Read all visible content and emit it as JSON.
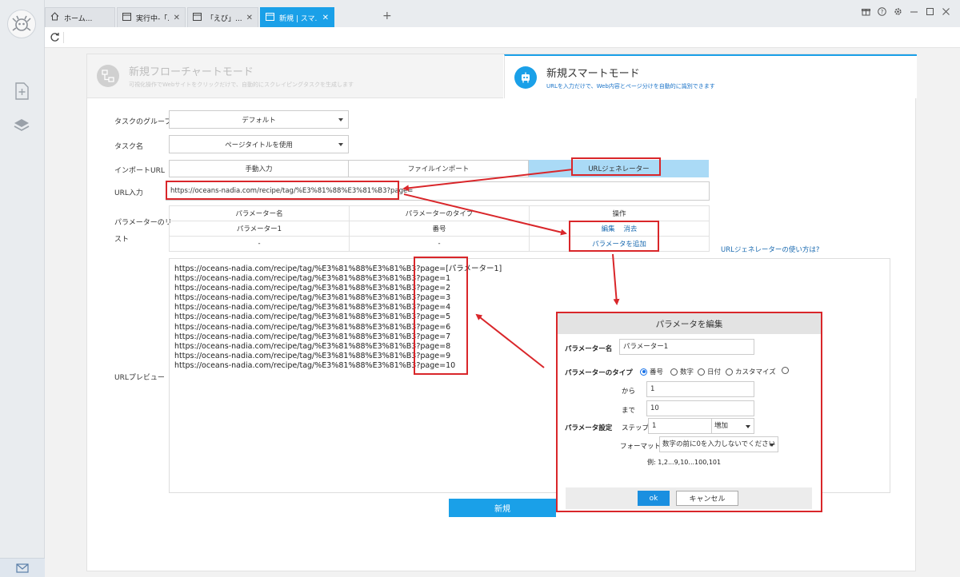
{
  "tabs": [
    {
      "label": "ホーム..."
    },
    {
      "label": "実行中-「..."
    },
    {
      "label": "「えび」..."
    },
    {
      "label": "新規 | スマ..."
    }
  ],
  "modes": {
    "flow": {
      "title": "新規フローチャートモード",
      "desc": "可視化操作でWebサイトをクリックだけで、自動的にスクレイピングタスクを生成します"
    },
    "smart": {
      "title": "新規スマートモード",
      "desc": "URLを入力だけで、Web内容とページ分けを自動的に識別できます"
    }
  },
  "form": {
    "group_label": "タスクのグループ",
    "group_value": "デフォルト",
    "name_label": "タスク名",
    "name_value": "ページタイトルを使用",
    "import_label": "インポートURL",
    "import_options": [
      "手動入力",
      "ファイルインポート",
      "URLジェネレーター"
    ],
    "url_label": "URL入力",
    "url_value": "https://oceans-nadia.com/recipe/tag/%E3%81%88%E3%81%B3?page=",
    "param_list_label_1": "パラメーターのリ",
    "param_list_label_2": "スト",
    "param_table": {
      "headers": [
        "パラメーター名",
        "パラメーターのタイプ",
        "操作"
      ],
      "row1": {
        "name": "パラメーター1",
        "type": "番号",
        "edit": "編集",
        "delete": "消去"
      },
      "row2": {
        "name": "-",
        "type": "-",
        "add": "パラメータを追加"
      }
    },
    "help_link": "URLジェネレーターの使い方は?",
    "preview_label": "URLプレビュー",
    "preview_lines": [
      "https://oceans-nadia.com/recipe/tag/%E3%81%88%E3%81%B3?page=[パラメーター1]",
      "https://oceans-nadia.com/recipe/tag/%E3%81%88%E3%81%B3?page=1",
      "https://oceans-nadia.com/recipe/tag/%E3%81%88%E3%81%B3?page=2",
      "https://oceans-nadia.com/recipe/tag/%E3%81%88%E3%81%B3?page=3",
      "https://oceans-nadia.com/recipe/tag/%E3%81%88%E3%81%B3?page=4",
      "https://oceans-nadia.com/recipe/tag/%E3%81%88%E3%81%B3?page=5",
      "https://oceans-nadia.com/recipe/tag/%E3%81%88%E3%81%B3?page=6",
      "https://oceans-nadia.com/recipe/tag/%E3%81%88%E3%81%B3?page=7",
      "https://oceans-nadia.com/recipe/tag/%E3%81%88%E3%81%B3?page=8",
      "https://oceans-nadia.com/recipe/tag/%E3%81%88%E3%81%B3?page=9",
      "https://oceans-nadia.com/recipe/tag/%E3%81%88%E3%81%B3?page=10"
    ],
    "create_button": "新規"
  },
  "dialog": {
    "title": "パラメータを編集",
    "name_label": "パラメーター名",
    "name_value": "パラメーター1",
    "type_label": "パラメーターのタイプ",
    "type_options": [
      "番号",
      "数字",
      "日付",
      "カスタマイズ"
    ],
    "selected_type": "番号",
    "from_label": "から",
    "from_value": "1",
    "to_label": "まで",
    "to_value": "10",
    "setting_label": "パラメータ設定",
    "step_label": "ステップ",
    "step_value": "1",
    "step_direction": "増加",
    "format_label": "フォーマット",
    "format_value": "数字の前に0を入力しないでください",
    "example": "例: 1,2...9,10...100,101",
    "ok_label": "ok",
    "cancel_label": "キャンセル"
  },
  "colors": {
    "accent": "#1aa0e8",
    "annotation": "#d9262a",
    "selected_segment": "#aadaf6"
  }
}
